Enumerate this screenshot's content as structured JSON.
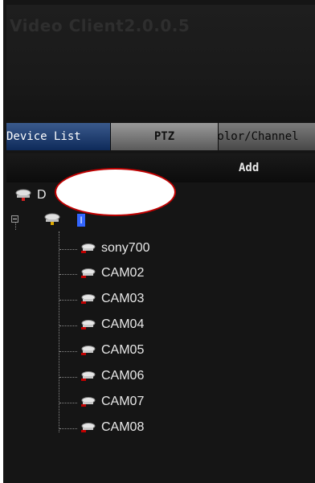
{
  "window": {
    "title": "Video Client2.0.0.5"
  },
  "tabs": [
    {
      "label": "Device List"
    },
    {
      "label": "PTZ"
    },
    {
      "label": "Color/Channel"
    }
  ],
  "toolbar": {
    "add_label": "Add"
  },
  "tree": {
    "root_label": "D",
    "group_label": "I",
    "cameras": [
      "sony700",
      "CAM02",
      "CAM03",
      "CAM04",
      "CAM05",
      "CAM06",
      "CAM07",
      "CAM08"
    ]
  },
  "icons": {
    "device": "camera-icon",
    "group": "network-icon",
    "expand": "collapse-icon"
  }
}
